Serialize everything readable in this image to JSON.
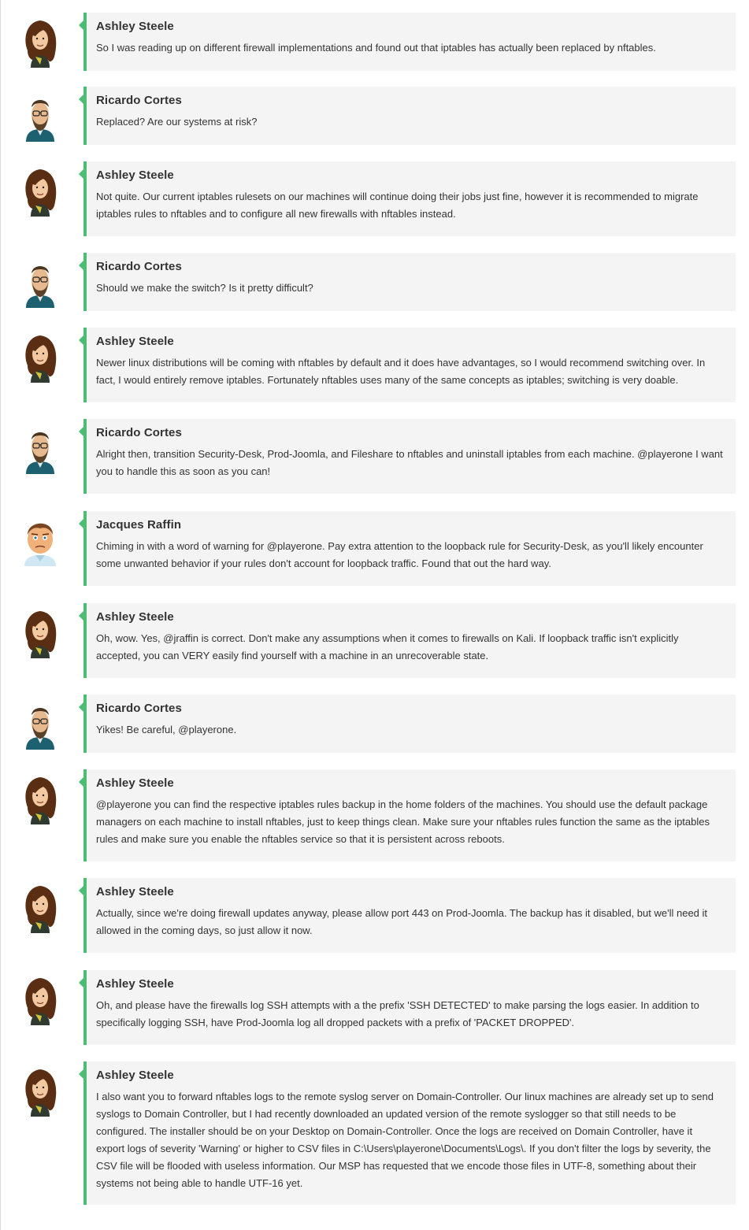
{
  "colors": {
    "accent": "#4dbd74",
    "bubble_bg": "#f4f4f4",
    "text": "#333333"
  },
  "messages": [
    {
      "author": "Ashley Steele",
      "avatar": "ashley-avatar-icon",
      "text": "So I was reading up on different firewall implementations and found out that iptables has actually been replaced by nftables."
    },
    {
      "author": "Ricardo Cortes",
      "avatar": "ricardo-avatar-icon",
      "text": "Replaced? Are our systems at risk?"
    },
    {
      "author": "Ashley Steele",
      "avatar": "ashley-avatar-icon",
      "text": "Not quite. Our current iptables rulesets on our machines will continue doing their jobs just fine, however it is recommended to migrate iptables rules to nftables and to configure all new firewalls with nftables instead."
    },
    {
      "author": "Ricardo Cortes",
      "avatar": "ricardo-avatar-icon",
      "text": "Should we make the switch? Is it pretty difficult?"
    },
    {
      "author": "Ashley Steele",
      "avatar": "ashley-avatar-icon",
      "text": "Newer linux distributions will be coming with nftables by default and it does have advantages, so I would recommend switching over. In fact, I would entirely remove iptables. Fortunately nftables uses many of the same concepts as iptables; switching is very doable."
    },
    {
      "author": "Ricardo Cortes",
      "avatar": "ricardo-avatar-icon",
      "text": "Alright then, transition Security-Desk, Prod-Joomla, and Fileshare to nftables and uninstall iptables from each machine. @playerone I want you to handle this as soon as you can!"
    },
    {
      "author": "Jacques Raffin",
      "avatar": "jacques-avatar-icon",
      "text": "Chiming in with a word of warning for @playerone. Pay extra attention to the loopback rule for Security-Desk, as you'll likely encounter some unwanted behavior if your rules don't account for loopback traffic. Found that out the hard way."
    },
    {
      "author": "Ashley Steele",
      "avatar": "ashley-avatar-icon",
      "text": "Oh, wow. Yes, @jraffin is correct. Don't make any assumptions when it comes to firewalls on Kali. If loopback traffic isn't explicitly accepted, you can VERY easily find yourself with a machine in an unrecoverable state."
    },
    {
      "author": "Ricardo Cortes",
      "avatar": "ricardo-avatar-icon",
      "text": "Yikes! Be careful, @playerone."
    },
    {
      "author": "Ashley Steele",
      "avatar": "ashley-avatar-icon",
      "text": "@playerone you can find the respective iptables rules backup in the home folders of the machines. You should use the default package managers on each machine to install nftables, just to keep things clean. Make sure your nftables rules function the same as the iptables rules and make sure you enable the nftables service so that it is persistent across reboots."
    },
    {
      "author": "Ashley Steele",
      "avatar": "ashley-avatar-icon",
      "text": "Actually, since we're doing firewall updates anyway, please allow port 443 on Prod-Joomla. The backup has it disabled, but we'll need it allowed in the coming days, so just allow it now."
    },
    {
      "author": "Ashley Steele",
      "avatar": "ashley-avatar-icon",
      "text": "Oh, and please have the firewalls log SSH attempts with a the prefix 'SSH DETECTED' to make parsing the logs easier. In addition to specifically logging SSH, have Prod-Joomla log all dropped packets with a prefix of 'PACKET DROPPED'."
    },
    {
      "author": "Ashley Steele",
      "avatar": "ashley-avatar-icon",
      "text": "I also want you to forward nftables logs to the remote syslog server on Domain-Controller. Our linux machines are already set up to send syslogs to Domain Controller, but I had recently downloaded an updated version of the remote syslogger so that still needs to be configured. The installer should be on your Desktop on Domain-Controller. Once the logs are received on Domain Controller, have it export logs of severity 'Warning' or higher to CSV files in C:\\Users\\playerone\\Documents\\Logs\\. If you don't filter the logs by severity, the CSV file will be flooded with useless information. Our MSP has requested that we encode those files in UTF-8, something about their systems not being able to handle UTF-16 yet."
    }
  ]
}
